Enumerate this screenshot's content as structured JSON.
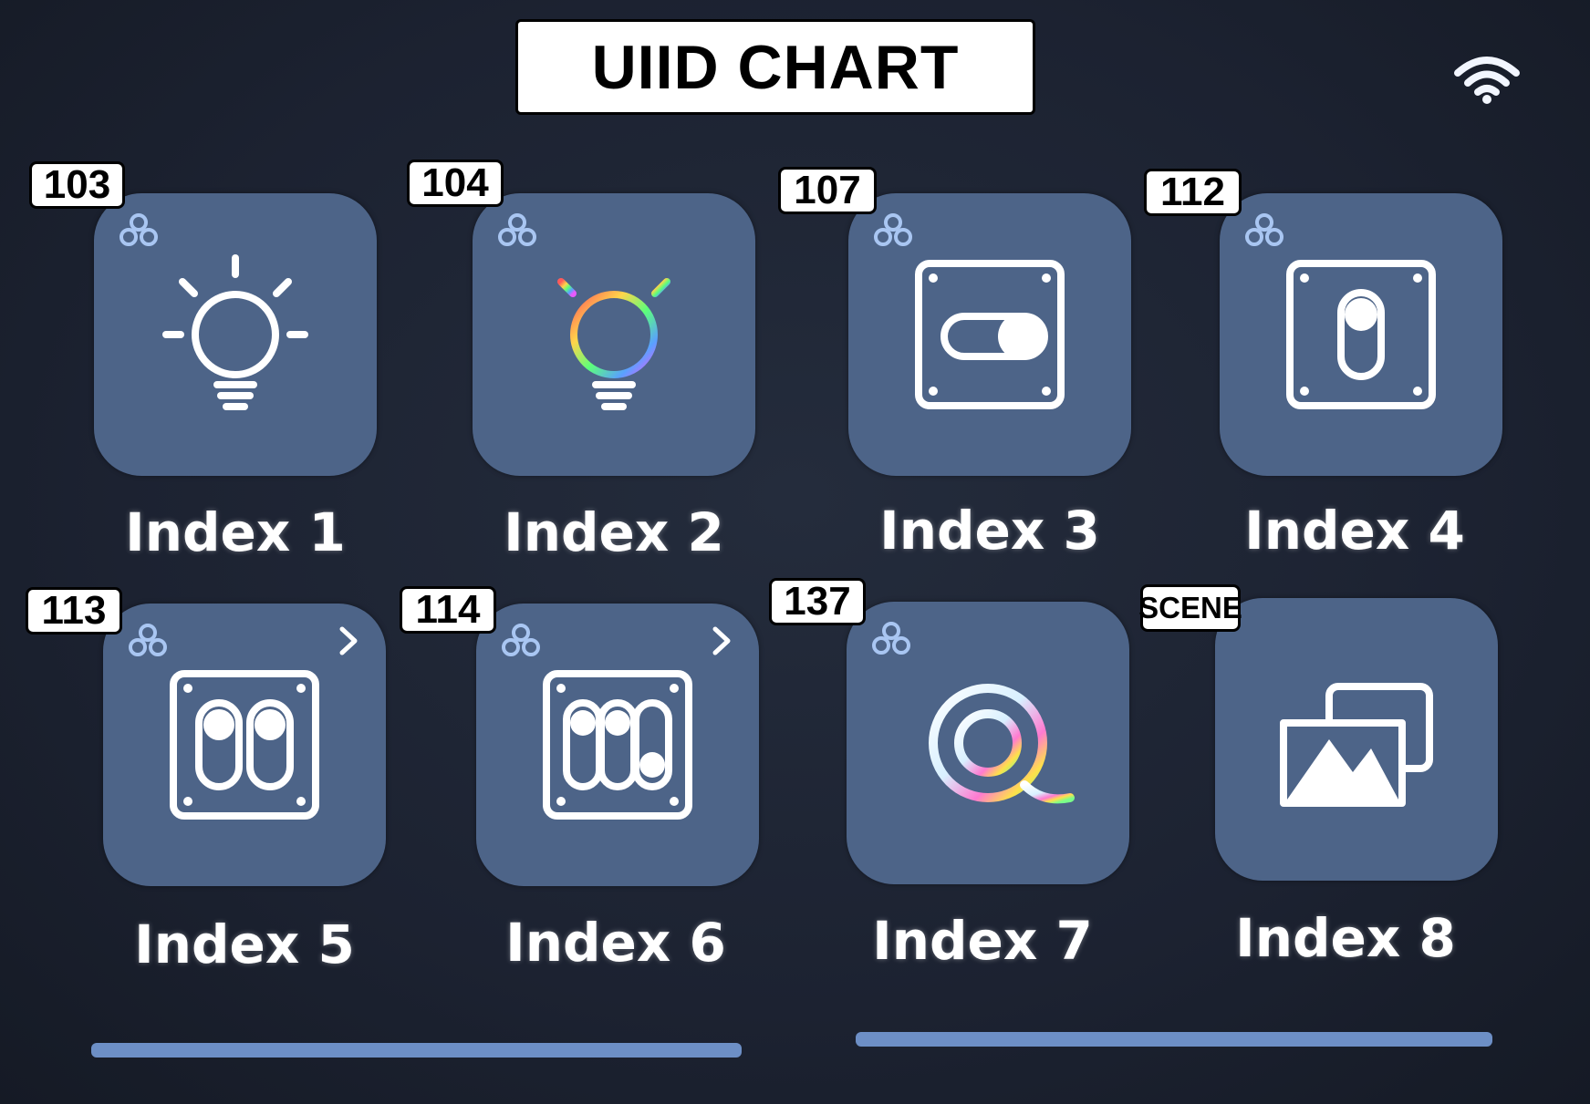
{
  "header": {
    "title": "UIID CHART"
  },
  "status": {
    "wifi_icon": "wifi-icon"
  },
  "colors": {
    "background": "#1c2231",
    "tile": "#4d6488",
    "accent": "#6d8fc6",
    "group_icon": "#a9c6f2"
  },
  "tiles": [
    {
      "label": "Index 1",
      "uiid": "103",
      "icon": "light-bulb-icon",
      "group_icon": true,
      "chevron": false
    },
    {
      "label": "Index 2",
      "uiid": "104",
      "icon": "rgb-light-bulb-icon",
      "group_icon": true,
      "chevron": false
    },
    {
      "label": "Index 3",
      "uiid": "107",
      "icon": "toggle-switch-off-icon",
      "group_icon": true,
      "chevron": false
    },
    {
      "label": "Index 4",
      "uiid": "112",
      "icon": "single-switch-icon",
      "group_icon": true,
      "chevron": false
    },
    {
      "label": "Index 5",
      "uiid": "113",
      "icon": "double-switch-icon",
      "group_icon": true,
      "chevron": true
    },
    {
      "label": "Index 6",
      "uiid": "114",
      "icon": "triple-switch-icon",
      "group_icon": true,
      "chevron": true
    },
    {
      "label": "Index 7",
      "uiid": "137",
      "icon": "led-strip-icon",
      "group_icon": true,
      "chevron": false
    },
    {
      "label": "Index 8",
      "uiid": "SCENE",
      "icon": "scene-icon",
      "group_icon": false,
      "chevron": false
    }
  ],
  "pager": {
    "pages": 2
  }
}
